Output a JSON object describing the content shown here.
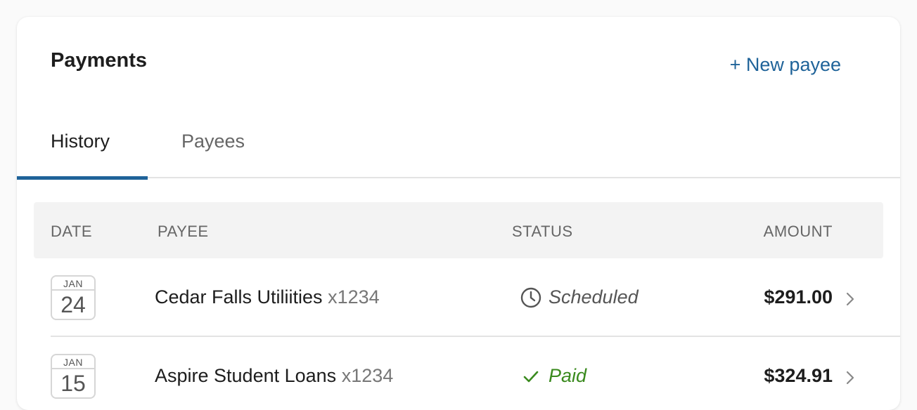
{
  "header": {
    "title": "Payments",
    "new_payee_label": "+ New payee"
  },
  "tabs": [
    {
      "label": "History",
      "active": true
    },
    {
      "label": "Payees",
      "active": false
    }
  ],
  "table": {
    "columns": [
      "DATE",
      "PAYEE",
      "STATUS",
      "AMOUNT"
    ],
    "rows": [
      {
        "month": "JAN",
        "day": "24",
        "payee": "Cedar Falls Utiliities",
        "account": "x1234",
        "status": "Scheduled",
        "status_icon": "clock-icon",
        "amount": "$291.00"
      },
      {
        "month": "JAN",
        "day": "15",
        "payee": "Aspire Student Loans",
        "account": "x1234",
        "status": "Paid",
        "status_icon": "check-icon",
        "amount": "$324.91"
      }
    ]
  },
  "colors": {
    "accent": "#1f6399",
    "paid": "#3a8a1e",
    "header_bg": "#f3f3f3"
  }
}
